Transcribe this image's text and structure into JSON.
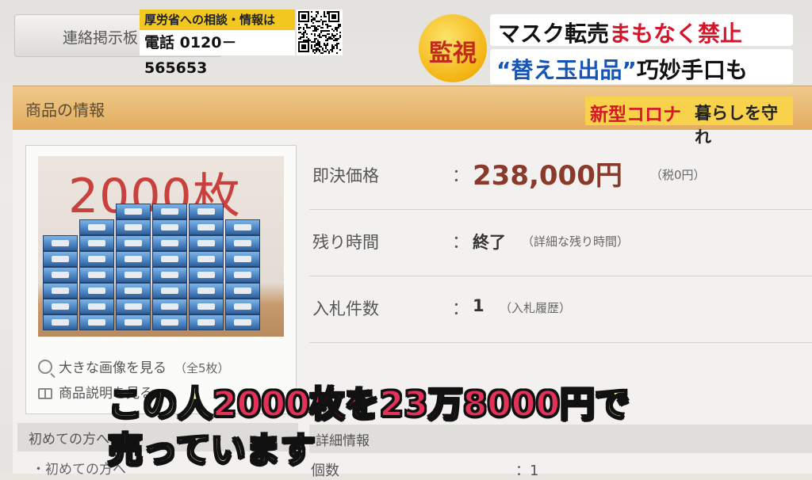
{
  "page": {
    "board_tab_label": "連絡掲示板",
    "section_title": "商品の情報",
    "photo_caption": "2000枚",
    "links": {
      "large_image": "大きな画像を見る",
      "large_image_note": "（全5枚）",
      "description": "商品説明を見る"
    },
    "rows": [
      {
        "label": "即決価格",
        "colon": "：",
        "value": "238,000円",
        "sub": "（税0円）"
      },
      {
        "label": "残り時間",
        "colon": "：",
        "value": "終了",
        "sub": "（詳細な残り時間）"
      },
      {
        "label": "入札件数",
        "colon": "：",
        "value": "1",
        "sub": "（入札履歴）"
      }
    ],
    "left_menu": {
      "heading": "初めての方へ",
      "item": "・初めての方へ"
    },
    "detail": {
      "heading": "詳細情報",
      "item": "個数",
      "value": "：1"
    }
  },
  "overlay": {
    "hotline_title": "厚労省への相談・情報は",
    "hotline_phone": "電話 0120－565653",
    "kanshi": "監視",
    "headline_line1_black": "マスク転売",
    "headline_line1_red": "まもなく禁止",
    "headline_line2_blue": "“替え玉出品”",
    "headline_line2_black": "巧妙手口も",
    "corona_red": "新型コロナ",
    "corona_black": "暮らしを守れ",
    "subtitle_line1_a": "この人",
    "subtitle_line1_b": "2000枚を23万8000円",
    "subtitle_line1_c": "で",
    "subtitle_line2": "売っています"
  },
  "colors": {
    "section_bar": "#e2ac5d",
    "price": "#8a3a2a",
    "headline_red": "#d6152a",
    "headline_blue": "#1755b4",
    "subtitle_yellow": "#fff7b0",
    "subtitle_pink": "#e3325a",
    "badge_yellow": "#f7d24a"
  }
}
